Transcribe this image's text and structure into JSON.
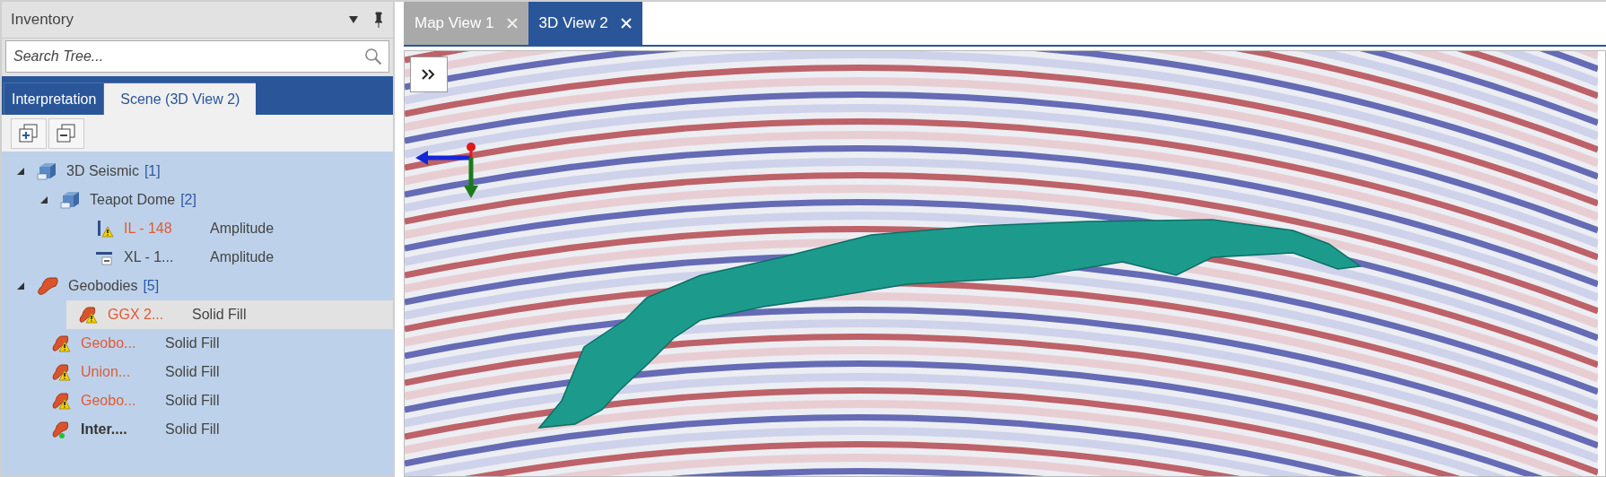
{
  "inventory": {
    "title": "Inventory",
    "search": {
      "placeholder": "Search Tree..."
    },
    "tabs": [
      {
        "label": "Interpretation",
        "selected": false
      },
      {
        "label": "Scene (3D View 2)",
        "selected": true
      }
    ],
    "tree": [
      {
        "kind": "volume-group",
        "label": "3D Seismic",
        "count": "[1]",
        "expanded": true,
        "selected": false,
        "children": [
          {
            "kind": "volume",
            "label": "Teapot Dome",
            "count": "[2]",
            "expanded": true,
            "selected": false,
            "children": [
              {
                "kind": "inline",
                "label": "IL - 148",
                "attribute": "Amplitude",
                "warning": true,
                "selected": false
              },
              {
                "kind": "crossline",
                "label": "XL - 1...",
                "attribute": "Amplitude",
                "warning": false,
                "selected": false
              }
            ]
          }
        ]
      },
      {
        "kind": "geobody-group",
        "label": "Geobodies",
        "count": "[5]",
        "expanded": true,
        "selected": false,
        "children": [
          {
            "kind": "geobody",
            "label": "GGX  2...",
            "attribute": "Solid Fill",
            "warning": true,
            "active": false,
            "selected": true
          },
          {
            "kind": "geobody",
            "label": "Geobo...",
            "attribute": "Solid Fill",
            "warning": true,
            "active": false,
            "selected": false
          },
          {
            "kind": "geobody",
            "label": "Union...",
            "attribute": "Solid Fill",
            "warning": true,
            "active": false,
            "selected": false
          },
          {
            "kind": "geobody",
            "label": "Geobo...",
            "attribute": "Solid Fill",
            "warning": true,
            "active": false,
            "selected": false
          },
          {
            "kind": "geobody",
            "label": "Inter....",
            "attribute": "Solid Fill",
            "warning": false,
            "active": true,
            "selected": false
          }
        ]
      }
    ]
  },
  "views": {
    "tabs": [
      {
        "label": "Map View 1",
        "selected": false
      },
      {
        "label": "3D View 2",
        "selected": true
      }
    ]
  }
}
